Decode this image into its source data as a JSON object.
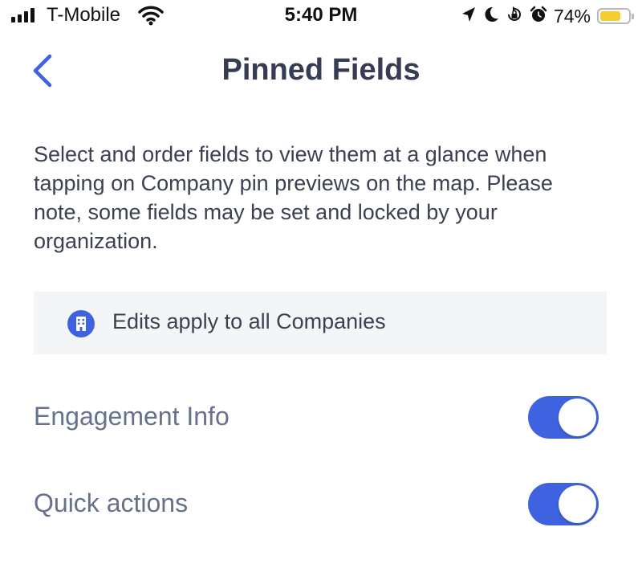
{
  "status_bar": {
    "carrier": "T-Mobile",
    "time": "5:40 PM",
    "battery_percent": "74%",
    "battery_level": 0.74,
    "battery_color": "#f6cd32",
    "icons": [
      "signal-icon",
      "wifi-icon",
      "location-arrow-icon",
      "moon-icon",
      "orientation-lock-icon",
      "alarm-icon",
      "battery-icon"
    ]
  },
  "nav": {
    "title": "Pinned Fields",
    "back_icon": "chevron-left-icon"
  },
  "description": "Select and order fields to view them at a glance when tapping on Company pin previews on the map. Please note, some fields may be set and locked by your organization.",
  "notice": {
    "icon": "building-icon",
    "text": "Edits apply to all Companies"
  },
  "fields": [
    {
      "label": "Engagement Info",
      "enabled": true
    },
    {
      "label": "Quick actions",
      "enabled": true
    }
  ],
  "colors": {
    "accent": "#3f63e0",
    "title": "#363d52",
    "label": "#66718a",
    "notice_bg": "#f4f5f7"
  }
}
